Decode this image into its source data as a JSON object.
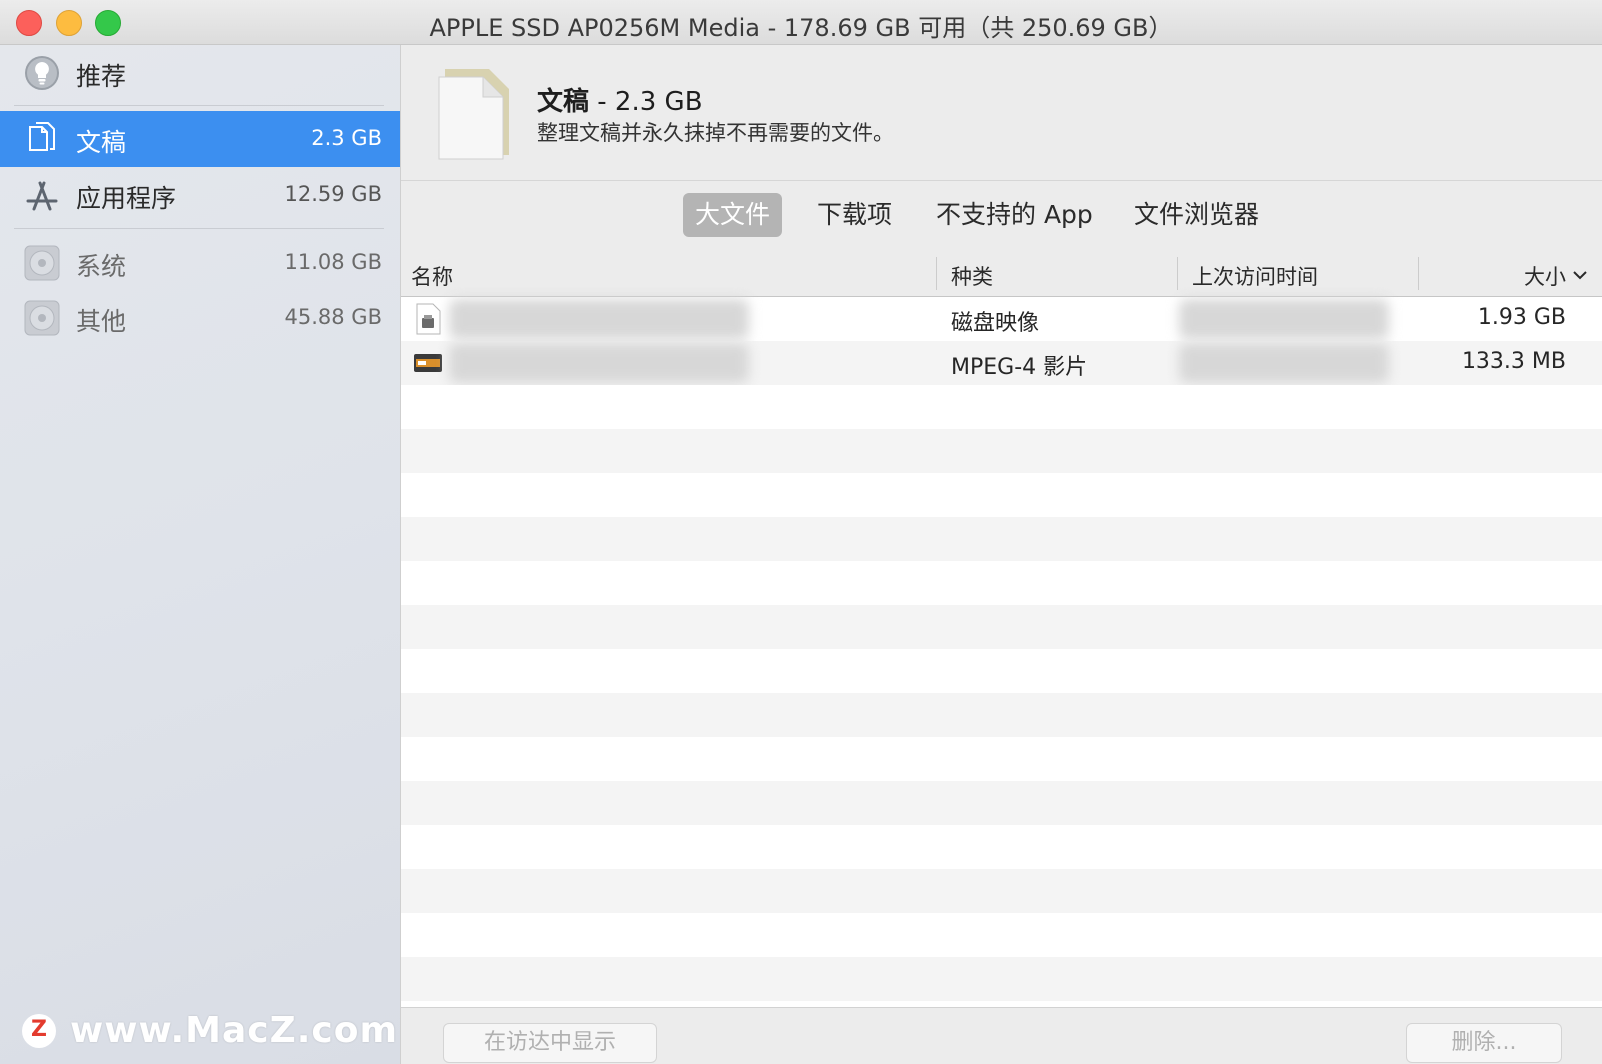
{
  "window": {
    "title": "APPLE SSD AP0256M Media - 178.69 GB 可用（共 250.69 GB）"
  },
  "sidebar": {
    "items": [
      {
        "label": "推荐",
        "size": "",
        "icon": "lightbulb-icon"
      },
      {
        "label": "文稿",
        "size": "2.3 GB",
        "icon": "documents-icon",
        "selected": true
      },
      {
        "label": "应用程序",
        "size": "12.59 GB",
        "icon": "app-store-icon"
      },
      {
        "label": "系统",
        "size": "11.08 GB",
        "icon": "disk-icon"
      },
      {
        "label": "其他",
        "size": "45.88 GB",
        "icon": "disk-icon"
      }
    ]
  },
  "header": {
    "title": "文稿",
    "size": " - 2.3 GB",
    "subtitle": "整理文稿并永久抹掉不再需要的文件。",
    "icon": "document-icon"
  },
  "tabs": [
    {
      "label": "大文件",
      "active": true
    },
    {
      "label": "下载项",
      "active": false
    },
    {
      "label": "不支持的 App",
      "active": false
    },
    {
      "label": "文件浏览器",
      "active": false
    }
  ],
  "table": {
    "columns": [
      "名称",
      "种类",
      "上次访问时间",
      "大小"
    ],
    "sort_indicator": "chevron-down-icon",
    "rows": [
      {
        "name": "",
        "kind": "磁盘映像",
        "last_accessed": "",
        "size": "1.93 GB",
        "icon": "disk-image-file-icon"
      },
      {
        "name": "",
        "kind": "MPEG-4 影片",
        "last_accessed": "",
        "size": "133.3 MB",
        "icon": "video-file-icon"
      }
    ]
  },
  "footer": {
    "show_in_finder_label": "在访达中显示",
    "delete_label": "删除..."
  },
  "watermark": {
    "text": "www.MacZ.com",
    "badge": "Z"
  },
  "colors": {
    "selection": "#3c8ff0",
    "close": "#fc605b",
    "minimize": "#fdbc40",
    "zoom": "#34c84a"
  }
}
